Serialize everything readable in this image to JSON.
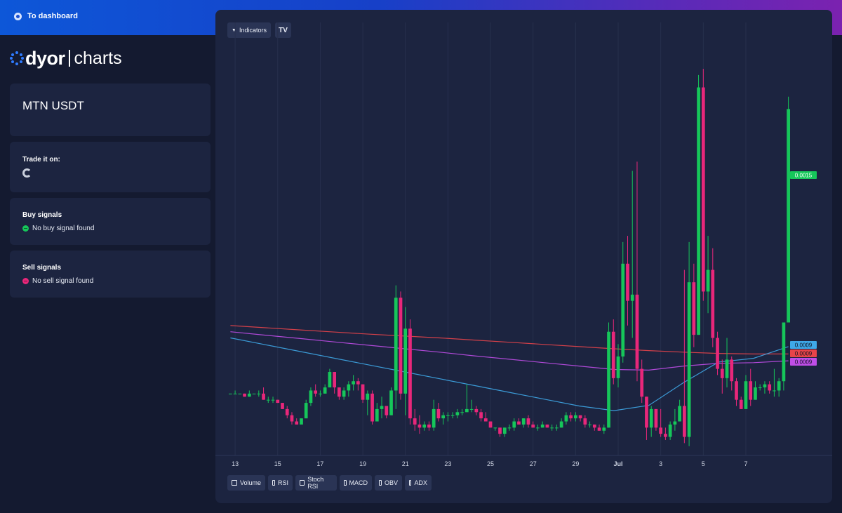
{
  "header": {
    "back_label": "To dashboard"
  },
  "logo": {
    "brand": "dyor",
    "product": "charts"
  },
  "pair": {
    "title": "MTN USDT"
  },
  "trade": {
    "title": "Trade it on:"
  },
  "buy": {
    "title": "Buy signals",
    "status": "No buy signal found",
    "color": "#16c65a"
  },
  "sell": {
    "title": "Sell signals",
    "status": "No sell signal found",
    "color": "#e8277a"
  },
  "toolbar": {
    "indicators_label": "Indicators",
    "tv_logo": "TV"
  },
  "indicators": [
    "Volume",
    "RSI",
    "Stoch RSI",
    "MACD",
    "OBV",
    "ADX"
  ],
  "colors": {
    "up": "#16c65a",
    "down": "#e8277a",
    "ma_fast": "#3fa8e8",
    "ma_mid": "#c04ee8",
    "ma_slow": "#e8444a"
  },
  "chart_data": {
    "type": "candlestick",
    "x_tick_labels": [
      "13",
      "15",
      "17",
      "19",
      "21",
      "23",
      "25",
      "27",
      "29",
      "Jul",
      "3",
      "5",
      "7"
    ],
    "price_labels": [
      {
        "value": "0.0015",
        "color": "#16c65a"
      },
      {
        "value": "0.0009",
        "color": "#3fa8e8"
      },
      {
        "value": "0.0009",
        "color": "#e8444a"
      },
      {
        "value": "0.0009",
        "color": "#c04ee8"
      }
    ],
    "ylim": [
      0.0004,
      0.0018
    ],
    "grid": "vertical",
    "candles": [
      [
        0.0006,
        0.0006,
        0.0006,
        0.0006
      ],
      [
        0.0006,
        0.00061,
        0.0006,
        0.0006
      ],
      [
        0.0006,
        0.0006,
        0.0006,
        0.0006
      ],
      [
        0.0006,
        0.0006,
        0.00059,
        0.00059
      ],
      [
        0.00059,
        0.00061,
        0.00059,
        0.0006
      ],
      [
        0.0006,
        0.0006,
        0.0006,
        0.0006
      ],
      [
        0.0006,
        0.00061,
        0.00059,
        0.0006
      ],
      [
        0.0006,
        0.00062,
        0.00058,
        0.00058
      ],
      [
        0.00058,
        0.00059,
        0.00057,
        0.00058
      ],
      [
        0.00058,
        0.00059,
        0.00057,
        0.00058
      ],
      [
        0.00058,
        0.00058,
        0.00057,
        0.00057
      ],
      [
        0.00057,
        0.00057,
        0.00055,
        0.00055
      ],
      [
        0.00055,
        0.00056,
        0.00052,
        0.00053
      ],
      [
        0.00053,
        0.00054,
        0.0005,
        0.00051
      ],
      [
        0.00051,
        0.00052,
        0.0005,
        0.0005
      ],
      [
        0.0005,
        0.00052,
        0.00052,
        0.00052
      ],
      [
        0.00052,
        0.00058,
        0.00052,
        0.00057
      ],
      [
        0.00057,
        0.00062,
        0.00056,
        0.00061
      ],
      [
        0.00061,
        0.00063,
        0.00059,
        0.0006
      ],
      [
        0.0006,
        0.00061,
        0.00059,
        0.0006
      ],
      [
        0.0006,
        0.00063,
        0.0006,
        0.00062
      ],
      [
        0.00062,
        0.00068,
        0.00062,
        0.00067
      ],
      [
        0.00067,
        0.00067,
        0.0006,
        0.00062
      ],
      [
        0.00062,
        0.00062,
        0.00058,
        0.00059
      ],
      [
        0.00059,
        0.00062,
        0.00058,
        0.00061
      ],
      [
        0.00061,
        0.00064,
        0.00059,
        0.00063
      ],
      [
        0.00063,
        0.00066,
        0.00061,
        0.00064
      ],
      [
        0.00064,
        0.00065,
        0.00061,
        0.00063
      ],
      [
        0.00063,
        0.00063,
        0.00057,
        0.00058
      ],
      [
        0.00058,
        0.00061,
        0.00053,
        0.0006
      ],
      [
        0.0006,
        0.00061,
        0.0005,
        0.00051
      ],
      [
        0.00051,
        0.00057,
        0.00051,
        0.00055
      ],
      [
        0.00055,
        0.00059,
        0.00052,
        0.00056
      ],
      [
        0.00056,
        0.00056,
        0.00052,
        0.00053
      ],
      [
        0.00053,
        0.00062,
        0.00053,
        0.00061
      ],
      [
        0.00061,
        0.00095,
        0.00055,
        0.00091
      ],
      [
        0.00091,
        0.00093,
        0.00058,
        0.0006
      ],
      [
        0.0006,
        0.00088,
        0.00053,
        0.00081
      ],
      [
        0.00081,
        0.00084,
        0.0005,
        0.00052
      ],
      [
        0.00052,
        0.00055,
        0.00048,
        0.0005
      ],
      [
        0.0005,
        0.00053,
        0.00047,
        0.00049
      ],
      [
        0.00049,
        0.00051,
        0.00048,
        0.0005
      ],
      [
        0.0005,
        0.00051,
        0.00048,
        0.00049
      ],
      [
        0.00049,
        0.00058,
        0.00048,
        0.00055
      ],
      [
        0.00055,
        0.00057,
        0.00051,
        0.00052
      ],
      [
        0.00052,
        0.00054,
        0.0005,
        0.00053
      ],
      [
        0.00053,
        0.00054,
        0.00051,
        0.00053
      ],
      [
        0.00053,
        0.00054,
        0.00052,
        0.00053
      ],
      [
        0.00053,
        0.00055,
        0.00052,
        0.00054
      ],
      [
        0.00054,
        0.00055,
        0.00053,
        0.00054
      ],
      [
        0.00054,
        0.00063,
        0.00054,
        0.00055
      ],
      [
        0.00055,
        0.00058,
        0.00054,
        0.00055
      ],
      [
        0.00055,
        0.00056,
        0.00053,
        0.00054
      ],
      [
        0.00054,
        0.00055,
        0.00051,
        0.00052
      ],
      [
        0.00052,
        0.00054,
        0.00051,
        0.00051
      ],
      [
        0.00051,
        0.00051,
        0.00049,
        0.00049
      ],
      [
        0.00049,
        0.00049,
        0.00048,
        0.00049
      ],
      [
        0.00049,
        0.00049,
        0.00046,
        0.00047
      ],
      [
        0.00047,
        0.00049,
        0.00046,
        0.00049
      ],
      [
        0.00049,
        0.0005,
        0.00048,
        0.00049
      ],
      [
        0.00049,
        0.00052,
        0.00048,
        0.00051
      ],
      [
        0.00051,
        0.00052,
        0.0005,
        0.0005
      ],
      [
        0.0005,
        0.00052,
        0.00049,
        0.00052
      ],
      [
        0.00052,
        0.00053,
        0.00049,
        0.0005
      ],
      [
        0.0005,
        0.00051,
        0.00049,
        0.00049
      ],
      [
        0.00049,
        0.0005,
        0.00048,
        0.00049
      ],
      [
        0.00049,
        0.00051,
        0.00049,
        0.0005
      ],
      [
        0.0005,
        0.0005,
        0.00049,
        0.00049
      ],
      [
        0.00049,
        0.0005,
        0.00048,
        0.00049
      ],
      [
        0.00049,
        0.0005,
        0.00048,
        0.00049
      ],
      [
        0.00049,
        0.00052,
        0.00049,
        0.00051
      ],
      [
        0.00051,
        0.00054,
        0.0005,
        0.00053
      ],
      [
        0.00053,
        0.00054,
        0.00051,
        0.00052
      ],
      [
        0.00052,
        0.00054,
        0.00051,
        0.00053
      ],
      [
        0.00053,
        0.00053,
        0.00051,
        0.00052
      ],
      [
        0.00052,
        0.00053,
        0.00049,
        0.0005
      ],
      [
        0.0005,
        0.00051,
        0.00049,
        0.0005
      ],
      [
        0.0005,
        0.0005,
        0.00048,
        0.00049
      ],
      [
        0.00049,
        0.0005,
        0.00048,
        0.00048
      ],
      [
        0.00048,
        0.0005,
        0.00047,
        0.00049
      ],
      [
        0.00049,
        0.00083,
        0.00049,
        0.0008
      ],
      [
        0.0008,
        0.00084,
        0.00063,
        0.00065
      ],
      [
        0.00065,
        0.00076,
        0.00062,
        0.00072
      ],
      [
        0.00072,
        0.00109,
        0.0007,
        0.00102
      ],
      [
        0.00102,
        0.00111,
        0.00082,
        0.0009
      ],
      [
        0.0009,
        0.00132,
        0.00078,
        0.00092
      ],
      [
        0.00092,
        0.00135,
        0.00064,
        0.00068
      ],
      [
        0.00068,
        0.00071,
        0.00057,
        0.00059
      ],
      [
        0.00059,
        0.00059,
        0.00045,
        0.00049
      ],
      [
        0.00049,
        0.00056,
        0.00046,
        0.00055
      ],
      [
        0.00055,
        0.00055,
        0.00048,
        0.00049
      ],
      [
        0.00049,
        0.00055,
        0.00046,
        0.00047
      ],
      [
        0.00047,
        0.00049,
        0.00045,
        0.00046
      ],
      [
        0.00046,
        0.00051,
        0.00045,
        0.0005
      ],
      [
        0.0005,
        0.00055,
        0.00048,
        0.00051
      ],
      [
        0.00051,
        0.00058,
        0.00051,
        0.00056
      ],
      [
        0.00056,
        0.001,
        0.00044,
        0.00046
      ],
      [
        0.00046,
        0.00109,
        0.00043,
        0.00096
      ],
      [
        0.00096,
        0.00102,
        0.00075,
        0.00079
      ],
      [
        0.00079,
        0.00163,
        0.00079,
        0.00159
      ],
      [
        0.00159,
        0.00165,
        0.0009,
        0.00093
      ],
      [
        0.00093,
        0.00111,
        0.00086,
        0.001
      ],
      [
        0.001,
        0.00107,
        0.00075,
        0.00078
      ],
      [
        0.00078,
        0.0008,
        0.00066,
        0.00068
      ],
      [
        0.00068,
        0.00071,
        0.0006,
        0.00065
      ],
      [
        0.00065,
        0.00078,
        0.00062,
        0.00071
      ],
      [
        0.00071,
        0.00072,
        0.00061,
        0.00064
      ],
      [
        0.00064,
        0.00065,
        0.00056,
        0.00058
      ],
      [
        0.00058,
        0.00059,
        0.00055,
        0.00055
      ],
      [
        0.00055,
        0.00066,
        0.00055,
        0.00064
      ],
      [
        0.00064,
        0.00068,
        0.00056,
        0.00058
      ],
      [
        0.00058,
        0.00064,
        0.00058,
        0.00062
      ],
      [
        0.00062,
        0.00063,
        0.00061,
        0.00062
      ],
      [
        0.00062,
        0.00064,
        0.0006,
        0.00063
      ],
      [
        0.00063,
        0.00064,
        0.0006,
        0.00061
      ],
      [
        0.00061,
        0.00068,
        0.00059,
        0.00061
      ],
      [
        0.00061,
        0.00065,
        0.00059,
        0.00064
      ],
      [
        0.00064,
        0.00083,
        0.00061,
        0.00083
      ],
      [
        0.00083,
        0.00156,
        0.00083,
        0.00152
      ]
    ],
    "ma_slow": [
      0.00082,
      0.000813,
      0.000806,
      0.000799,
      0.000792,
      0.000786,
      0.00078,
      0.000773,
      0.000766,
      0.000759,
      0.000752,
      0.000745,
      0.000739,
      0.000734,
      0.00073,
      0.000728,
      0.000728
    ],
    "ma_mid": [
      0.0008,
      0.000789,
      0.000778,
      0.000767,
      0.000756,
      0.000745,
      0.000734,
      0.000722,
      0.000711,
      0.0007,
      0.000689,
      0.000678,
      0.000676,
      0.000689,
      0.000698,
      0.0007,
      0.000706
    ],
    "ma_fast": [
      0.00078,
      0.000758,
      0.000736,
      0.000714,
      0.000692,
      0.00067,
      0.000648,
      0.000626,
      0.000604,
      0.000582,
      0.00056,
      0.000545,
      0.000562,
      0.000636,
      0.000702,
      0.000714,
      0.000752
    ]
  }
}
